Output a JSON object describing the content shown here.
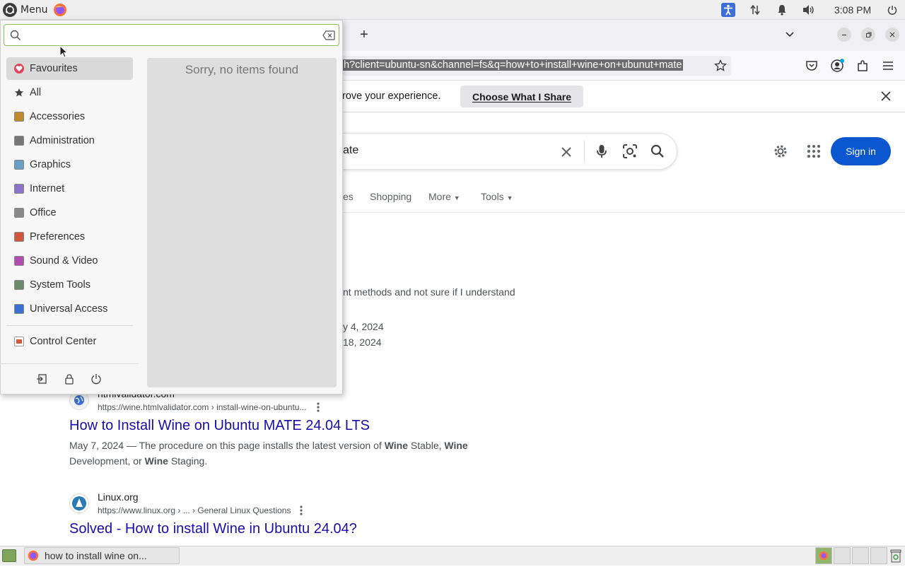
{
  "top_panel": {
    "menu_label": "Menu",
    "clock": "3:08 PM",
    "icons": [
      "ubuntu-mate-logo",
      "firefox-icon",
      "accessibility-icon",
      "network-icon",
      "notification-bell-icon",
      "volume-icon",
      "power-icon"
    ]
  },
  "browser": {
    "new_tab": "+",
    "url": "h?client=ubuntu-sn&channel=fs&q=how+to+install+wine+on+ubunut+mate",
    "infobar_text": "rove your experience.",
    "infobar_button": "Choose What I Share",
    "search_query_fragment": "ate",
    "sign_in": "Sign in",
    "tabs": [
      "es",
      "Shopping",
      "More",
      "Tools"
    ]
  },
  "results": {
    "partial_snippet": "nt methods and not sure if I understand",
    "partial_date_1": "y 4, 2024",
    "partial_date_2": "18, 2024",
    "r1": {
      "site": "htmlvalidator.com",
      "url": "https://wine.htmlvalidator.com › install-wine-on-ubuntu...",
      "title": "How to Install Wine on Ubuntu MATE 24.04 LTS",
      "date": "May 7, 2024",
      "dash": " — The procedure on this page installs the latest version of ",
      "b1": "Wine",
      "t1": " Stable, ",
      "b2": "Wine",
      "t2": "Development, or ",
      "b3": "Wine",
      "t3": " Staging."
    },
    "r2": {
      "site": "Linux.org",
      "url": "https://www.linux.org › ... › General Linux Questions",
      "title": "Solved - How to install Wine in Ubuntu 24.04?"
    }
  },
  "menu": {
    "search_placeholder": "",
    "empty_message": "Sorry, no items found",
    "categories": [
      {
        "label": "Favourites",
        "color": "#e0455a"
      },
      {
        "label": "All",
        "color": "#444444"
      },
      {
        "label": "Accessories",
        "color": "#c08b2e"
      },
      {
        "label": "Administration",
        "color": "#777777"
      },
      {
        "label": "Graphics",
        "color": "#6aa0c8"
      },
      {
        "label": "Internet",
        "color": "#8c72c9"
      },
      {
        "label": "Office",
        "color": "#888888"
      },
      {
        "label": "Preferences",
        "color": "#d0573e"
      },
      {
        "label": "Sound & Video",
        "color": "#b44bb3"
      },
      {
        "label": "System Tools",
        "color": "#6b8a6b"
      },
      {
        "label": "Universal Access",
        "color": "#3a6fd6"
      }
    ],
    "control_center": "Control Center",
    "bottom_icons": [
      "logout-icon",
      "lock-icon",
      "power-icon"
    ]
  },
  "taskbar": {
    "window_title": "how to install wine on..."
  },
  "colors": {
    "accent_blue": "#0b57d0",
    "link": "#1a0dab",
    "search_border_focus": "#8dbf5a"
  }
}
